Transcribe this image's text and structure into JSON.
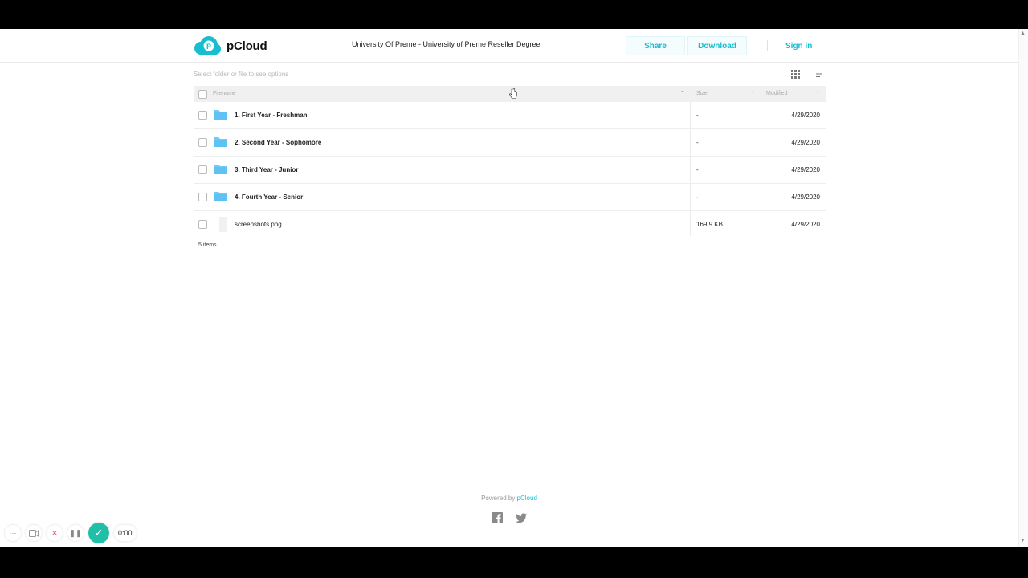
{
  "header": {
    "brand": "pCloud",
    "title": "University Of Preme - University of Preme Reseller Degree",
    "share_label": "Share",
    "download_label": "Download",
    "signin_label": "Sign in",
    "accent_color": "#17bed0"
  },
  "toolbar": {
    "hint": "Select folder or file to see options",
    "grid_view_icon": "grid-icon",
    "sort_icon": "sort-icon"
  },
  "table": {
    "columns": {
      "filename": "Filename",
      "size": "Size",
      "modified": "Modified"
    },
    "rows": [
      {
        "name": "1. First Year - Freshman",
        "type": "folder",
        "size": "-",
        "modified": "4/29/2020"
      },
      {
        "name": "2. Second Year - Sophomore",
        "type": "folder",
        "size": "-",
        "modified": "4/29/2020"
      },
      {
        "name": "3. Third Year - Junior",
        "type": "folder",
        "size": "-",
        "modified": "4/29/2020"
      },
      {
        "name": "4. Fourth Year - Senior",
        "type": "folder",
        "size": "-",
        "modified": "4/29/2020"
      },
      {
        "name": "screenshots.png",
        "type": "file",
        "size": "169.9 KB",
        "modified": "4/29/2020"
      }
    ],
    "count": "5 items"
  },
  "footer": {
    "powered_by": "Powered by ",
    "brand": "pCloud",
    "social": [
      "facebook-icon",
      "twitter-icon"
    ]
  },
  "recorder": {
    "more": "···",
    "time": "0:00"
  }
}
